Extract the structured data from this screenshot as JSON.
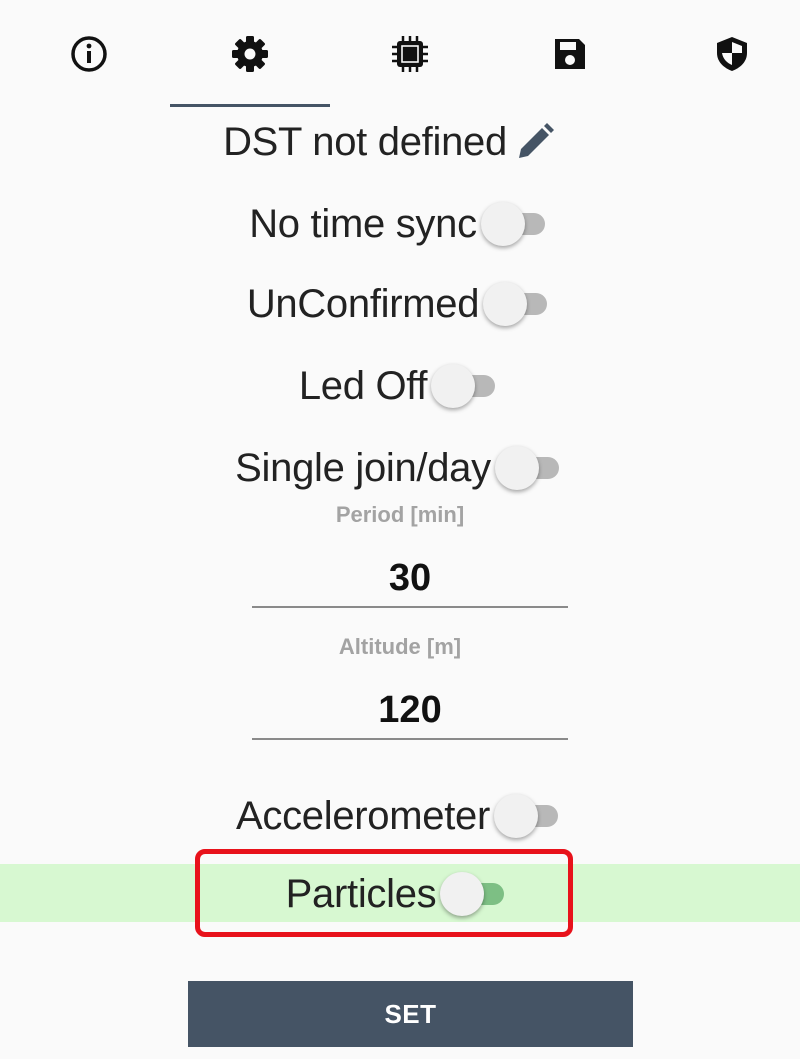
{
  "tabs": [
    {
      "icon": "info-icon",
      "selected": false
    },
    {
      "icon": "gear-icon",
      "selected": true
    },
    {
      "icon": "chip-icon",
      "selected": false
    },
    {
      "icon": "save-icon",
      "selected": false
    },
    {
      "icon": "shield-icon",
      "selected": false
    }
  ],
  "settings": {
    "dst_label": "DST not defined",
    "dst_edit_icon": "pencil-icon",
    "no_time_sync": {
      "label": "No time sync",
      "on": false
    },
    "unconfirmed": {
      "label": "UnConfirmed",
      "on": false
    },
    "led_off": {
      "label": "Led Off",
      "on": false
    },
    "single_join": {
      "label": "Single join/day",
      "on": false
    },
    "period": {
      "label": "Period [min]",
      "value": "30"
    },
    "altitude": {
      "label": "Altitude [m]",
      "value": "120"
    },
    "accelerometer": {
      "label": "Accelerometer",
      "on": false
    },
    "particles": {
      "label": "Particles",
      "on": false
    }
  },
  "set_button_label": "SET",
  "colors": {
    "tab_indicator": "#455465",
    "highlight": "#d7f8d1",
    "annotation_box": "#e8121b",
    "button": "#455465"
  }
}
